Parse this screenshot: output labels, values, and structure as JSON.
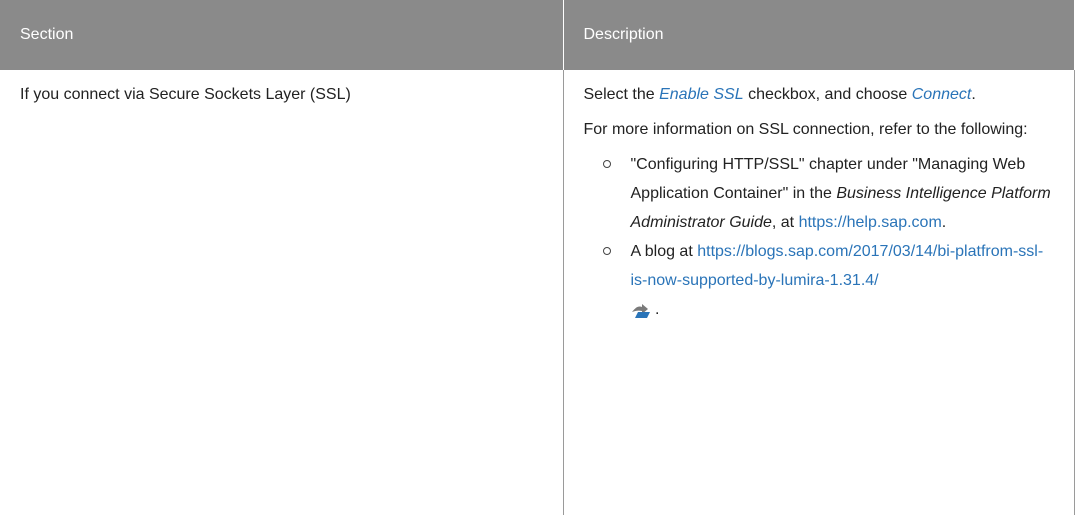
{
  "table": {
    "headers": {
      "section": "Section",
      "description": "Description"
    },
    "row": {
      "section": "If you connect via Secure Sockets Layer (SSL)",
      "p1": {
        "pre": "Select the ",
        "ui1": "Enable SSL",
        "mid": " checkbox, and choose ",
        "ui2": "Connect",
        "post": "."
      },
      "p2": "For more information on SSL connection, refer to the following:",
      "bullets": [
        {
          "pre": "\"Configuring HTTP/SSL\" chapter under \"Manag­ing Web Application Container\" in the ",
          "em": "Business Intelligence Platform Administrator Guide",
          "mid": ", at ",
          "link": "https://help.sap.com",
          "post": "."
        },
        {
          "pre": "A blog at ",
          "link": "https://blogs.sap.com/2017/03/14/bi-platfrom-ssl-is-now-supported-by-lumira-1.31.4/",
          "post": " ."
        }
      ]
    }
  },
  "icons": {
    "external_link": "external-link-icon"
  },
  "colors": {
    "header_bg": "#8a8a8a",
    "link": "#2a74b8"
  }
}
